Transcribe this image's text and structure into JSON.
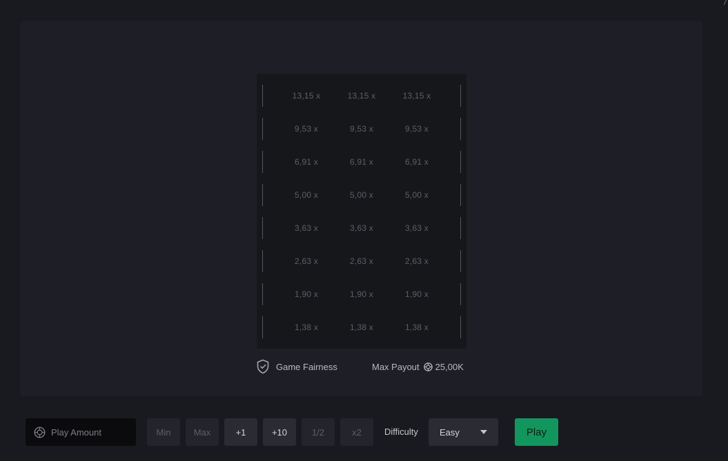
{
  "tower": {
    "rows": [
      {
        "cells": [
          "13,15 x",
          "13,15 x",
          "13,15 x"
        ]
      },
      {
        "cells": [
          "9,53 x",
          "9,53 x",
          "9,53 x"
        ]
      },
      {
        "cells": [
          "6,91 x",
          "6,91 x",
          "6,91 x"
        ]
      },
      {
        "cells": [
          "5,00 x",
          "5,00 x",
          "5,00 x"
        ]
      },
      {
        "cells": [
          "3,63 x",
          "3,63 x",
          "3,63 x"
        ]
      },
      {
        "cells": [
          "2,63 x",
          "2,63 x",
          "2,63 x"
        ]
      },
      {
        "cells": [
          "1,90 x",
          "1,90 x",
          "1,90 x"
        ]
      },
      {
        "cells": [
          "1,38 x",
          "1,38 x",
          "1,38 x"
        ]
      }
    ]
  },
  "info": {
    "fairness_label": "Game Fairness",
    "fairness_icon": "shield-check-icon",
    "max_payout_label": "Max Payout",
    "max_payout_icon": "coin-icon",
    "max_payout_value": "25,00K"
  },
  "controls": {
    "amount_placeholder": "Play Amount",
    "amount_value": "",
    "amount_icon": "coin-icon",
    "buttons": {
      "min": "Min",
      "max": "Max",
      "plus1": "+1",
      "plus10": "+10",
      "half": "1/2",
      "double": "x2"
    },
    "difficulty_label": "Difficulty",
    "difficulty_value": "Easy",
    "play_label": "Play"
  },
  "colors": {
    "background": "#191a1f",
    "panel": "#1e1f26",
    "tower_bg": "#16171b",
    "accent_green": "#13965e"
  }
}
